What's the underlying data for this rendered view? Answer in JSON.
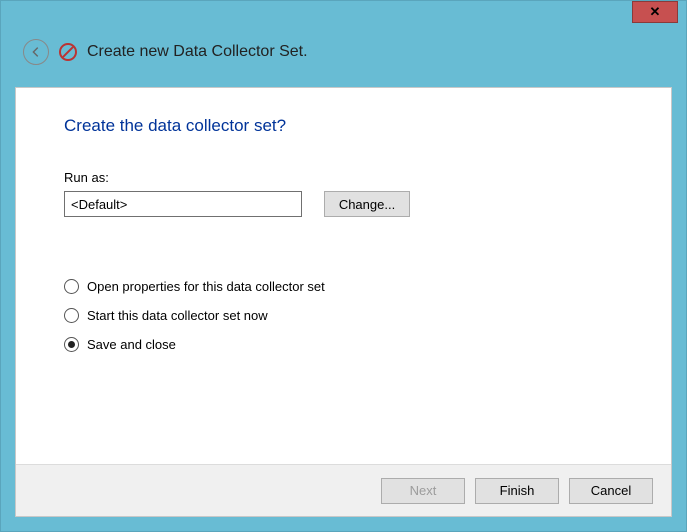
{
  "window": {
    "title": "Create new Data Collector Set."
  },
  "page": {
    "heading": "Create the data collector set?",
    "runas_label": "Run as:",
    "runas_value": "<Default>",
    "change_label": "Change...",
    "options": [
      {
        "label": "Open properties for this data collector set",
        "checked": false
      },
      {
        "label": "Start this data collector set now",
        "checked": false
      },
      {
        "label": "Save and close",
        "checked": true
      }
    ]
  },
  "footer": {
    "next": "Next",
    "finish": "Finish",
    "cancel": "Cancel"
  }
}
